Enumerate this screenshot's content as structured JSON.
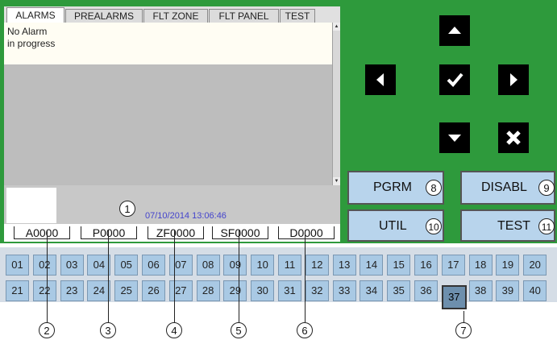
{
  "tabs": [
    "ALARMS",
    "PREALARMS",
    "FLT ZONE",
    "FLT PANEL",
    "TEST"
  ],
  "alarm_message": [
    "No Alarm",
    "in progress"
  ],
  "datetime": "07/10/2014 13:06:46",
  "counters": [
    "A0000",
    "P0000",
    "ZF0000",
    "SF0000",
    "D0000"
  ],
  "buttons": {
    "pgrm": "PGRM",
    "disabl": "DISABL",
    "util": "UTIL",
    "test": "TEST"
  },
  "zones_row1": [
    "01",
    "02",
    "03",
    "04",
    "05",
    "06",
    "07",
    "08",
    "09",
    "10",
    "11",
    "12",
    "13",
    "14",
    "15",
    "16",
    "17",
    "18",
    "19",
    "20"
  ],
  "zones_row2": [
    "21",
    "22",
    "23",
    "24",
    "25",
    "26",
    "27",
    "28",
    "29",
    "30",
    "31",
    "32",
    "33",
    "34",
    "35",
    "36",
    "37",
    "38",
    "39",
    "40"
  ],
  "selected_zone": "37",
  "callouts": [
    "1",
    "2",
    "3",
    "4",
    "5",
    "6",
    "7",
    "8",
    "9",
    "10",
    "11"
  ],
  "colors": {
    "panel": "#2e9a3c",
    "zone": "#a9c9e4",
    "button": "#b8d4ec",
    "datetime": "#4444cc"
  }
}
